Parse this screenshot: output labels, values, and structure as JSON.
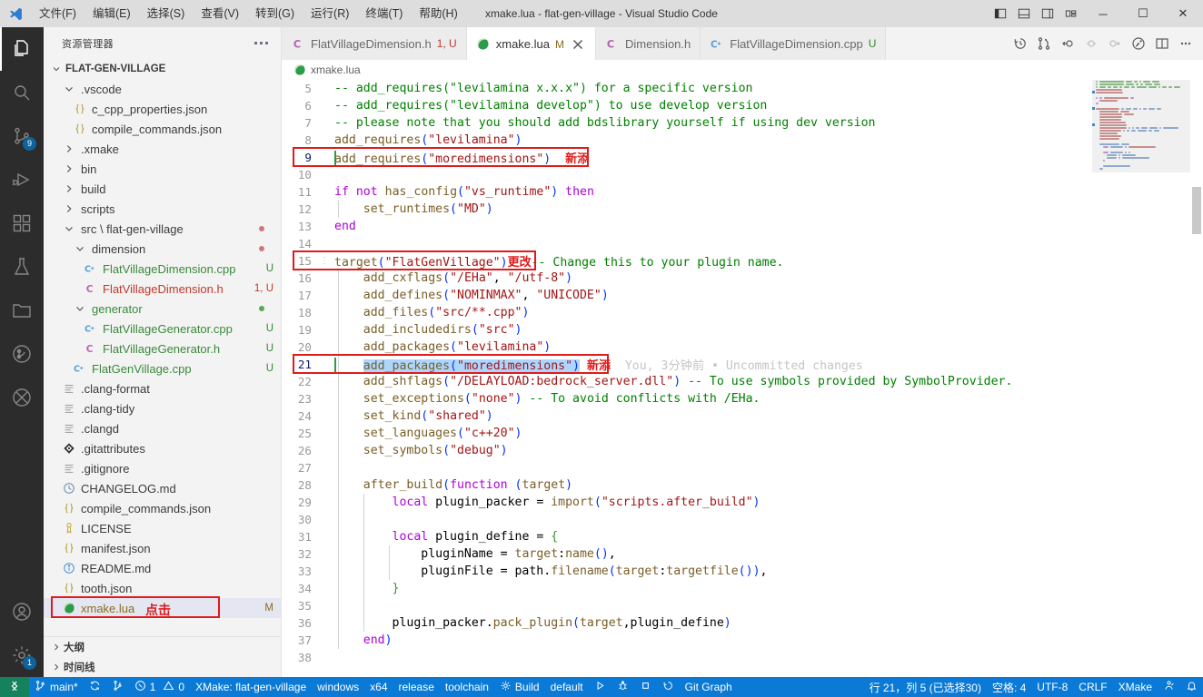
{
  "titlebar": {
    "logo_icon": "vscode-logo-icon",
    "menus": [
      "文件(F)",
      "编辑(E)",
      "选择(S)",
      "查看(V)",
      "转到(G)",
      "运行(R)",
      "终端(T)",
      "帮助(H)"
    ],
    "window_title": "xmake.lua - flat-gen-village - Visual Studio Code",
    "layout_buttons": [
      "toggle-primary-sidebar-icon",
      "toggle-panel-icon",
      "toggle-secondary-sidebar-icon",
      "customize-layout-icon"
    ],
    "window_buttons": {
      "minimize": "─",
      "maximize": "☐",
      "close": "✕"
    }
  },
  "activitybar": {
    "items": [
      {
        "name": "explorer",
        "icon": "files-icon",
        "active": true,
        "badge": ""
      },
      {
        "name": "search",
        "icon": "search-icon",
        "active": false,
        "badge": ""
      },
      {
        "name": "source-control",
        "icon": "source-control-icon",
        "active": false,
        "badge": "9"
      },
      {
        "name": "run-and-debug",
        "icon": "debug-alt-icon",
        "active": false,
        "badge": ""
      },
      {
        "name": "extensions",
        "icon": "extensions-icon",
        "active": false,
        "badge": ""
      },
      {
        "name": "testing",
        "icon": "beaker-icon",
        "active": false,
        "badge": ""
      },
      {
        "name": "explorer-alt",
        "icon": "folder-icon",
        "active": false,
        "badge": ""
      },
      {
        "name": "git-graph",
        "icon": "git-graph-icon",
        "active": false,
        "badge": ""
      },
      {
        "name": "remote",
        "icon": "remote-slash-icon",
        "active": false,
        "badge": ""
      }
    ],
    "bottom": [
      {
        "name": "accounts",
        "icon": "account-icon",
        "badge": ""
      },
      {
        "name": "manage",
        "icon": "gear-icon",
        "badge": "1"
      }
    ]
  },
  "sidebar": {
    "title": "资源管理器",
    "more_actions_icon": "ellipsis-icon",
    "root": {
      "label": "FLAT-GEN-VILLAGE",
      "expanded": true
    },
    "tree": [
      {
        "label": ".vscode",
        "indent": 1,
        "icon": "chevron-down-icon",
        "kind": "folder",
        "expanded": true,
        "meta": "",
        "dot": ""
      },
      {
        "label": "c_cpp_properties.json",
        "indent": 2,
        "icon": "json-icon",
        "kind": "file",
        "meta": "",
        "dot": ""
      },
      {
        "label": "compile_commands.json",
        "indent": 2,
        "icon": "json-icon",
        "kind": "file",
        "meta": "",
        "dot": ""
      },
      {
        "label": ".xmake",
        "indent": 1,
        "icon": "chevron-right-icon",
        "kind": "folder",
        "expanded": false,
        "meta": "",
        "dot": ""
      },
      {
        "label": "bin",
        "indent": 1,
        "icon": "chevron-right-icon",
        "kind": "folder",
        "expanded": false,
        "meta": "",
        "dot": ""
      },
      {
        "label": "build",
        "indent": 1,
        "icon": "chevron-right-icon",
        "kind": "folder",
        "expanded": false,
        "meta": "",
        "dot": ""
      },
      {
        "label": "scripts",
        "indent": 1,
        "icon": "chevron-right-icon",
        "kind": "folder",
        "expanded": false,
        "meta": "",
        "dot": ""
      },
      {
        "label": "src \\ flat-gen-village",
        "indent": 1,
        "icon": "chevron-down-icon",
        "kind": "folder",
        "expanded": true,
        "meta": "",
        "dot": "#d1777a"
      },
      {
        "label": "dimension",
        "indent": 2,
        "icon": "chevron-down-icon",
        "kind": "folder",
        "expanded": true,
        "meta": "",
        "dot": "#d1777a"
      },
      {
        "label": "FlatVillageDimension.cpp",
        "indent": 3,
        "icon": "cpp-icon",
        "kind": "file",
        "meta": "U",
        "meta_color": "#2e8b2e",
        "label_color": "#3a8a3a",
        "dot": ""
      },
      {
        "label": "FlatVillageDimension.h",
        "indent": 3,
        "icon": "c-header-icon",
        "kind": "file",
        "meta": "1, U",
        "meta_color": "#c0392b",
        "label_color": "#c0392b",
        "dot": ""
      },
      {
        "label": "generator",
        "indent": 2,
        "icon": "chevron-down-icon",
        "kind": "folder",
        "expanded": true,
        "label_color": "#3a8a3a",
        "meta": "",
        "dot": "#57a957"
      },
      {
        "label": "FlatVillageGenerator.cpp",
        "indent": 3,
        "icon": "cpp-icon",
        "kind": "file",
        "meta": "U",
        "meta_color": "#2e8b2e",
        "label_color": "#3a8a3a",
        "dot": ""
      },
      {
        "label": "FlatVillageGenerator.h",
        "indent": 3,
        "icon": "c-header-icon",
        "kind": "file",
        "meta": "U",
        "meta_color": "#2e8b2e",
        "label_color": "#3a8a3a",
        "dot": ""
      },
      {
        "label": "FlatGenVillage.cpp",
        "indent": 2,
        "icon": "cpp-icon",
        "kind": "file",
        "meta": "U",
        "meta_color": "#2e8b2e",
        "label_color": "#3a8a3a",
        "dot": ""
      },
      {
        "label": ".clang-format",
        "indent": 1,
        "icon": "settings-file-icon",
        "kind": "file",
        "meta": "",
        "dot": ""
      },
      {
        "label": ".clang-tidy",
        "indent": 1,
        "icon": "settings-file-icon",
        "kind": "file",
        "meta": "",
        "dot": ""
      },
      {
        "label": ".clangd",
        "indent": 1,
        "icon": "settings-file-icon",
        "kind": "file",
        "meta": "",
        "dot": ""
      },
      {
        "label": ".gitattributes",
        "indent": 1,
        "icon": "git-icon",
        "kind": "file",
        "meta": "",
        "dot": ""
      },
      {
        "label": ".gitignore",
        "indent": 1,
        "icon": "settings-file-icon",
        "kind": "file",
        "meta": "",
        "dot": ""
      },
      {
        "label": "CHANGELOG.md",
        "indent": 1,
        "icon": "clock-icon",
        "kind": "file",
        "meta": "",
        "dot": ""
      },
      {
        "label": "compile_commands.json",
        "indent": 1,
        "icon": "json-icon",
        "kind": "file",
        "meta": "",
        "dot": ""
      },
      {
        "label": "LICENSE",
        "indent": 1,
        "icon": "license-icon",
        "kind": "file",
        "meta": "",
        "dot": ""
      },
      {
        "label": "manifest.json",
        "indent": 1,
        "icon": "json-icon",
        "kind": "file",
        "meta": "",
        "dot": ""
      },
      {
        "label": "README.md",
        "indent": 1,
        "icon": "info-icon",
        "kind": "file",
        "meta": "",
        "dot": ""
      },
      {
        "label": "tooth.json",
        "indent": 1,
        "icon": "json-icon",
        "kind": "file",
        "meta": "",
        "dot": ""
      },
      {
        "label": "xmake.lua",
        "indent": 1,
        "icon": "lua-icon",
        "kind": "file",
        "meta": "M",
        "meta_color": "#8a6d1f",
        "label_color": "#8a6d1f",
        "selected": true,
        "dot": ""
      }
    ],
    "annotation": {
      "label": "点击",
      "color": "#e01b1b"
    },
    "bottom_sections": [
      {
        "label": "大纲",
        "icon": "chevron-right-icon"
      },
      {
        "label": "时间线",
        "icon": "chevron-right-icon"
      }
    ]
  },
  "editor": {
    "tabs": [
      {
        "label": "FlatVillageDimension.h",
        "icon": "c-header-icon",
        "meta": "1, U",
        "active": false,
        "dirty": false
      },
      {
        "label": "xmake.lua",
        "icon": "lua-icon",
        "meta": "M",
        "active": true,
        "dirty": true,
        "close_icon": "close-icon"
      },
      {
        "label": "Dimension.h",
        "icon": "c-header-icon",
        "meta": "",
        "active": false,
        "dirty": false
      },
      {
        "label": "FlatVillageDimension.cpp",
        "icon": "cpp-icon",
        "meta": "U",
        "active": false,
        "dirty": false
      }
    ],
    "actions": [
      "timeline-icon",
      "compare-changes-icon",
      "go-to-previous-change-icon",
      "go-to-change-icon",
      "go-to-next-change-icon",
      "run-lua-icon",
      "split-editor-icon",
      "more-actions-icon"
    ],
    "breadcrumb": {
      "icon": "lua-icon",
      "label": "xmake.lua"
    },
    "blame": "You, 3分钟前 • Uncommitted changes",
    "annotations": [
      {
        "line": 9,
        "label": "新添",
        "color": "#e01b1b"
      },
      {
        "line": 15,
        "label": "更改",
        "color": "#e01b1b"
      },
      {
        "line": 21,
        "label": "新添",
        "color": "#e01b1b"
      }
    ],
    "lines": [
      {
        "n": 5,
        "text": "-- add_requires(\"levilamina x.x.x\") for a specific version"
      },
      {
        "n": 6,
        "text": "-- add_requires(\"levilamina develop\") to use develop version"
      },
      {
        "n": 7,
        "text": "-- please note that you should add bdslibrary yourself if using dev version"
      },
      {
        "n": 8,
        "text": "add_requires(\"levilamina\")"
      },
      {
        "n": 9,
        "text": "add_requires(\"moredimensions\")"
      },
      {
        "n": 10,
        "text": ""
      },
      {
        "n": 11,
        "text": "if not has_config(\"vs_runtime\") then"
      },
      {
        "n": 12,
        "text": "    set_runtimes(\"MD\")"
      },
      {
        "n": 13,
        "text": "end"
      },
      {
        "n": 14,
        "text": ""
      },
      {
        "n": 15,
        "text": "target(\"FlatGenVillage\") -- Change this to your plugin name."
      },
      {
        "n": 16,
        "text": "    add_cxflags(\"/EHa\", \"/utf-8\")"
      },
      {
        "n": 17,
        "text": "    add_defines(\"NOMINMAX\", \"UNICODE\")"
      },
      {
        "n": 18,
        "text": "    add_files(\"src/**.cpp\")"
      },
      {
        "n": 19,
        "text": "    add_includedirs(\"src\")"
      },
      {
        "n": 20,
        "text": "    add_packages(\"levilamina\")"
      },
      {
        "n": 21,
        "text": "    add_packages(\"moredimensions\")"
      },
      {
        "n": 22,
        "text": "    add_shflags(\"/DELAYLOAD:bedrock_server.dll\") -- To use symbols provided by SymbolProvider."
      },
      {
        "n": 23,
        "text": "    set_exceptions(\"none\") -- To avoid conflicts with /EHa."
      },
      {
        "n": 24,
        "text": "    set_kind(\"shared\")"
      },
      {
        "n": 25,
        "text": "    set_languages(\"c++20\")"
      },
      {
        "n": 26,
        "text": "    set_symbols(\"debug\")"
      },
      {
        "n": 27,
        "text": ""
      },
      {
        "n": 28,
        "text": "    after_build(function (target)"
      },
      {
        "n": 29,
        "text": "        local plugin_packer = import(\"scripts.after_build\")"
      },
      {
        "n": 30,
        "text": ""
      },
      {
        "n": 31,
        "text": "        local plugin_define = {"
      },
      {
        "n": 32,
        "text": "            pluginName = target:name(),"
      },
      {
        "n": 33,
        "text": "            pluginFile = path.filename(target:targetfile()),"
      },
      {
        "n": 34,
        "text": "        }"
      },
      {
        "n": 35,
        "text": ""
      },
      {
        "n": 36,
        "text": "        plugin_packer.pack_plugin(target,plugin_define)"
      },
      {
        "n": 37,
        "text": "    end)"
      },
      {
        "n": 38,
        "text": ""
      }
    ]
  },
  "statusbar": {
    "remote_icon": "remote-window-icon",
    "left": [
      {
        "icon": "source-control-icon",
        "label": "main*"
      },
      {
        "icon": "sync-icon",
        "label": ""
      },
      {
        "icon": "branch-icon",
        "label": ""
      },
      {
        "icon": "error-icon",
        "label": "1",
        "icon2": "warning-icon",
        "label2": "0"
      },
      {
        "icon": "",
        "label": "XMake: flat-gen-village"
      },
      {
        "icon": "",
        "label": "windows"
      },
      {
        "icon": "",
        "label": "x64"
      },
      {
        "icon": "",
        "label": "release"
      },
      {
        "icon": "",
        "label": "toolchain"
      },
      {
        "icon": "gear-icon",
        "label": "Build"
      },
      {
        "icon": "",
        "label": "default"
      },
      {
        "icon": "play-icon",
        "label": ""
      },
      {
        "icon": "debug-icon",
        "label": ""
      },
      {
        "icon": "stop-icon",
        "label": ""
      },
      {
        "icon": "history-icon",
        "label": ""
      },
      {
        "icon": "",
        "label": "Git Graph"
      }
    ],
    "right": [
      {
        "icon": "",
        "label": "行 21，列 5 (已选择30)"
      },
      {
        "icon": "",
        "label": "空格: 4"
      },
      {
        "icon": "",
        "label": "UTF-8"
      },
      {
        "icon": "",
        "label": "CRLF"
      },
      {
        "icon": "",
        "label": "XMake"
      },
      {
        "icon": "feedback-icon",
        "label": ""
      },
      {
        "icon": "bell-icon",
        "label": ""
      }
    ]
  },
  "colors": {
    "titlebar_bg": "#dddddd",
    "activitybar_bg": "#2c2c2c",
    "sidebar_bg": "#f3f3f3",
    "editor_bg": "#ffffff",
    "statusbar_bg": "#0a7ad6",
    "remote_bg": "#16825d",
    "annotation_red": "#e01b1b",
    "selection_blue": "#add6ff",
    "badge_blue": "#0e639c"
  }
}
